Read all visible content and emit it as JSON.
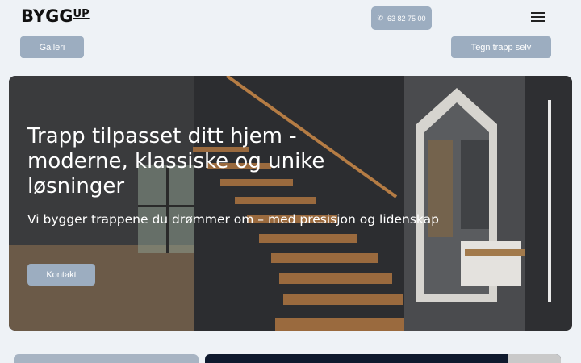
{
  "header": {
    "logo_main": "BYGG",
    "logo_accent": "UP",
    "phone_label": "63 82 75 00",
    "phone_icon": "phone-icon",
    "menu_icon": "hamburger-menu-icon"
  },
  "nav": {
    "galleri_label": "Galleri",
    "tegn_label": "Tegn trapp selv"
  },
  "hero": {
    "title": "Trapp tilpasset ditt hjem - moderne, klassiske og unike løsninger",
    "subtitle": "Vi bygger trappene du drømmer om – med presisjon og lidenskap",
    "button_label": "Kontakt"
  },
  "colors": {
    "background": "#eef2f6",
    "button": "#9cadc0",
    "dark_card": "#0f1a2e"
  }
}
